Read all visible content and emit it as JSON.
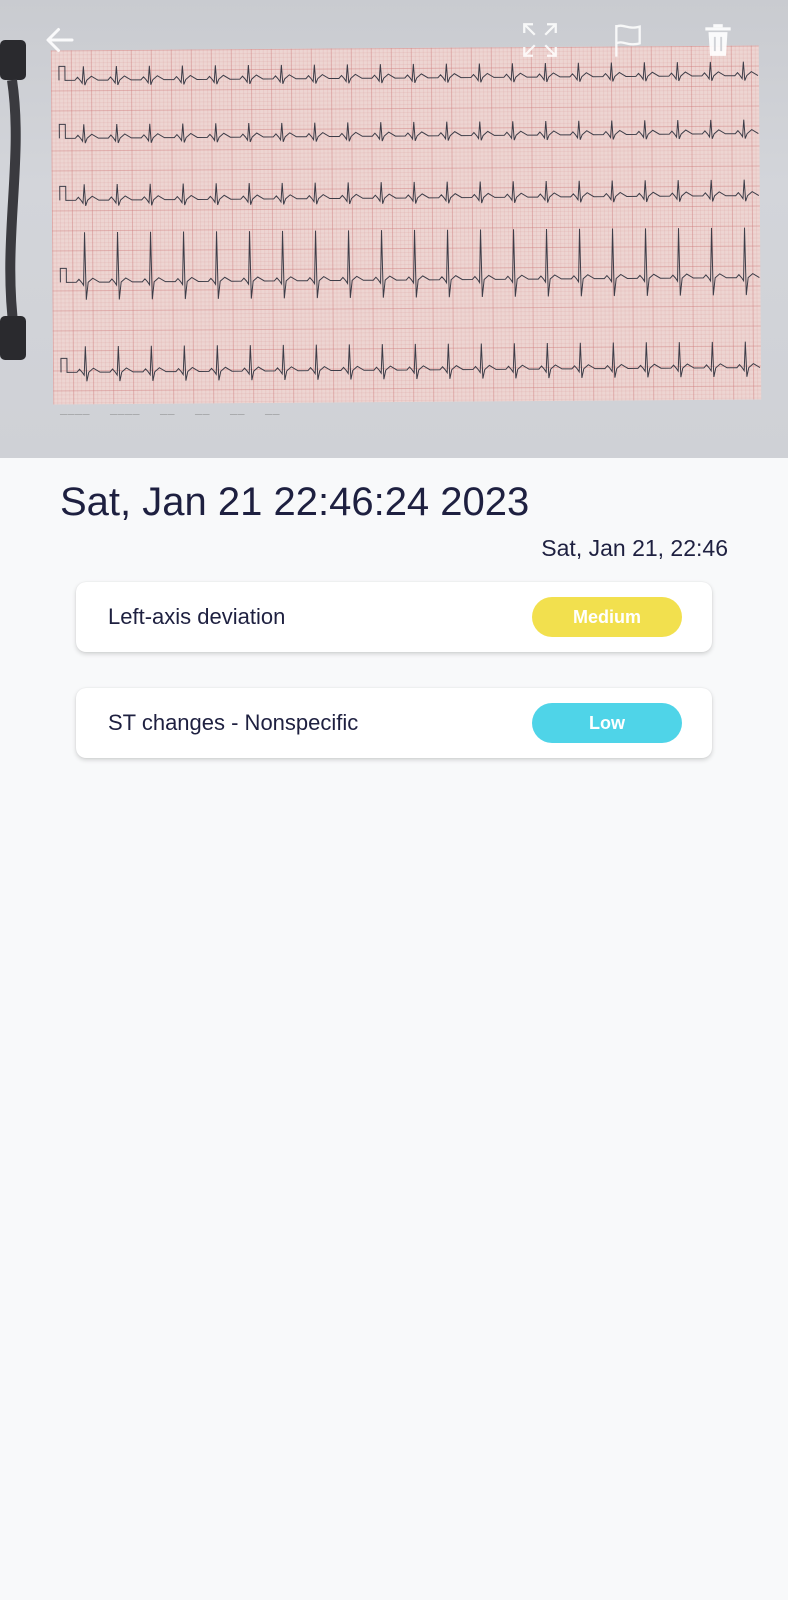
{
  "header": {
    "back_icon": "arrow-left-icon",
    "actions": [
      {
        "name": "fullscreen-icon"
      },
      {
        "name": "flag-icon"
      },
      {
        "name": "trash-icon"
      }
    ]
  },
  "record": {
    "title": "Sat, Jan 21 22:46:24 2023",
    "short_date": "Sat, Jan 21, 22:46"
  },
  "findings": [
    {
      "label": "Left-axis deviation",
      "severity": "Medium",
      "color": "#f2e04e"
    },
    {
      "label": "ST changes - Nonspecific",
      "severity": "Low",
      "color": "#4fd4e8"
    }
  ],
  "colors": {
    "text": "#1e2040",
    "background": "#f8f9fa",
    "medium": "#f2e04e",
    "low": "#4fd4e8"
  }
}
